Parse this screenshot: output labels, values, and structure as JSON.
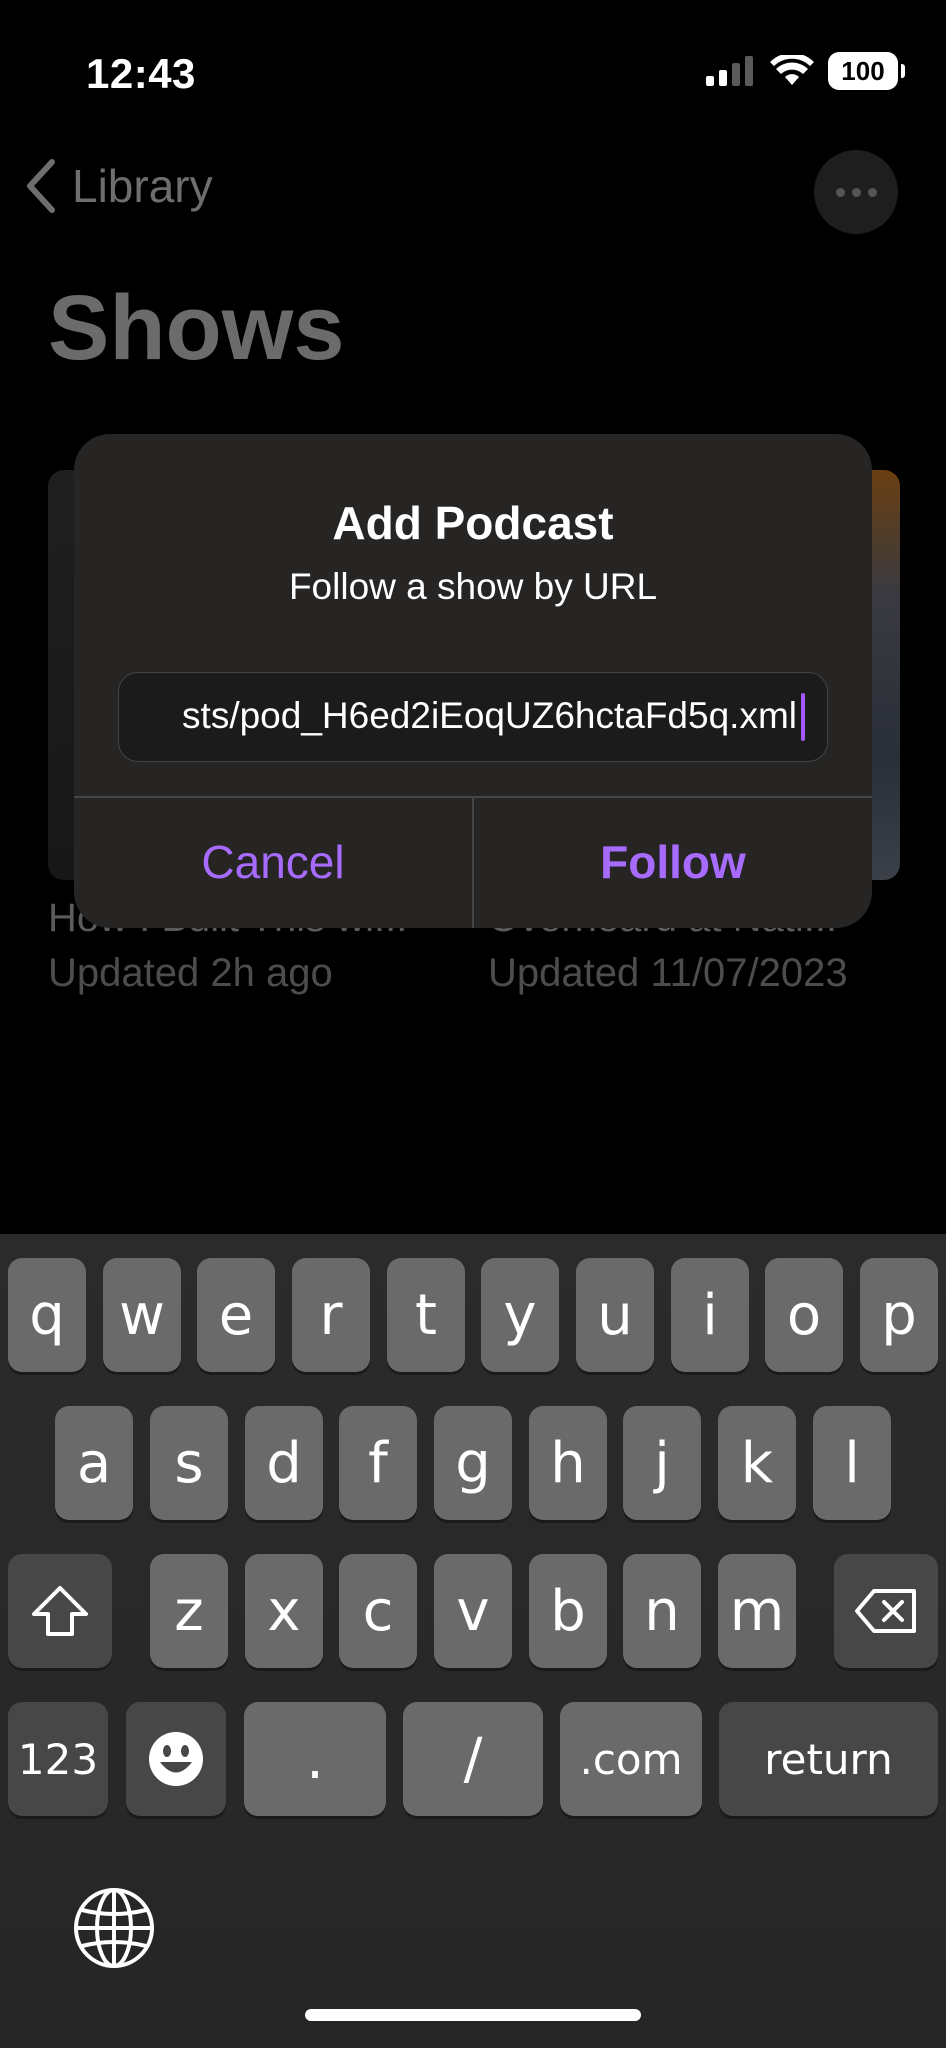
{
  "status_bar": {
    "time": "12:43",
    "battery": "100"
  },
  "nav": {
    "back_label": "Library",
    "more_icon": "ellipsis-icon"
  },
  "page": {
    "title": "Shows",
    "shows": [
      {
        "name": "How I Built This wi...",
        "updated": "Updated 2h ago"
      },
      {
        "name": "Overheard at Nati...",
        "updated": "Updated 11/07/2023"
      }
    ]
  },
  "dialog": {
    "title": "Add Podcast",
    "subtitle": "Follow a show by URL",
    "url_value": "sts/pod_H6ed2iEoqUZ6hctaFd5q.xml",
    "cancel_label": "Cancel",
    "follow_label": "Follow",
    "accent_color": "#a86bff"
  },
  "keyboard": {
    "row1": [
      "q",
      "w",
      "e",
      "r",
      "t",
      "y",
      "u",
      "i",
      "o",
      "p"
    ],
    "row2": [
      "a",
      "s",
      "d",
      "f",
      "g",
      "h",
      "j",
      "k",
      "l"
    ],
    "row3": [
      "z",
      "x",
      "c",
      "v",
      "b",
      "n",
      "m"
    ],
    "numbers_label": "123",
    "dot_label": ".",
    "slash_label": "/",
    "dotcom_label": ".com",
    "return_label": "return"
  }
}
